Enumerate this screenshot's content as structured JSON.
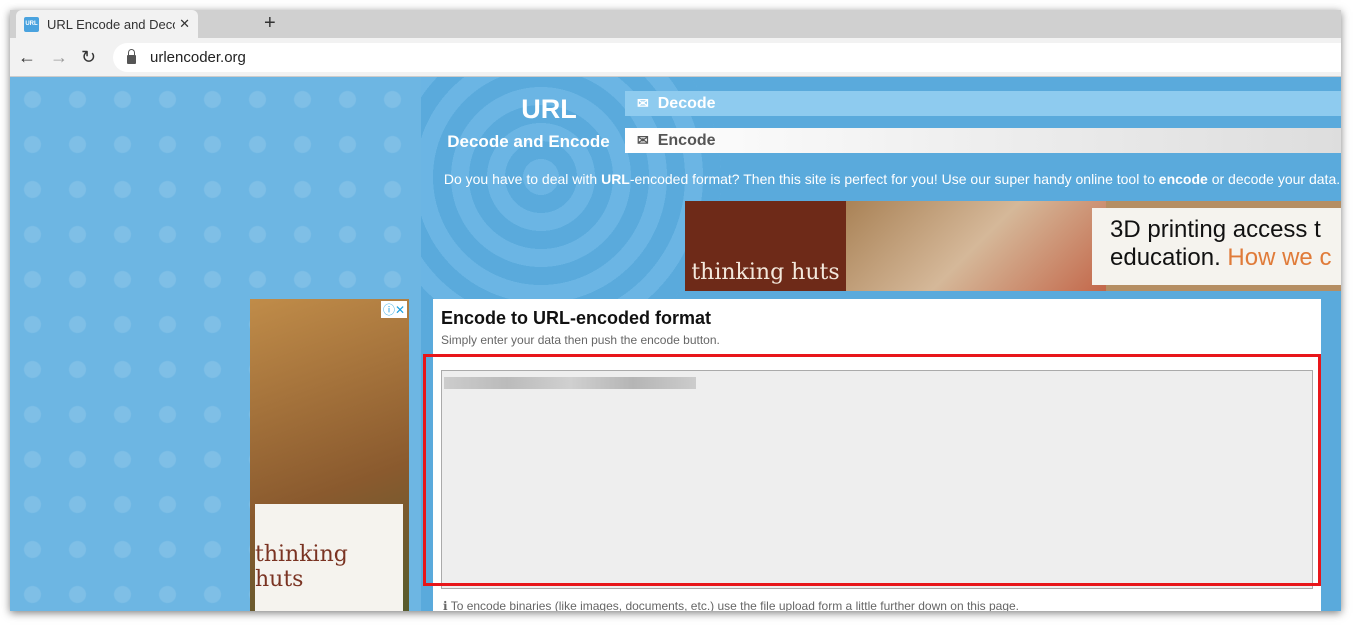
{
  "browser": {
    "tab_title": "URL Encode and Decode - (",
    "favicon": "URL",
    "url": "urlencoder.org"
  },
  "header": {
    "logo_main": "URL",
    "logo_sub": "Decode and Encode",
    "nav": [
      {
        "label": "Decode",
        "icon": "envelope-open-icon"
      },
      {
        "label": "Encode",
        "icon": "envelope-icon"
      }
    ],
    "intro": {
      "a": "Do you have to deal with ",
      "b": "URL",
      "c": "-encoded format? Then this site is perfect for you! Use our super handy online tool to ",
      "d": "encode",
      "e": " or decode your data."
    }
  },
  "banner_ad": {
    "brand": "thinking huts",
    "line1": "3D printing access t",
    "line2a": "education. ",
    "line2b": "How we c"
  },
  "side_ad": {
    "brand": "thinking huts",
    "info": "ⓘ✕"
  },
  "main": {
    "title": "Encode to URL-encoded format",
    "subtitle": "Simply enter your data then push the encode button.",
    "input_value": "",
    "note": "To encode binaries (like images, documents, etc.) use the file upload form a little further down on this page."
  },
  "colors": {
    "accent": "#5aaadc",
    "highlight": "#e8161a"
  }
}
